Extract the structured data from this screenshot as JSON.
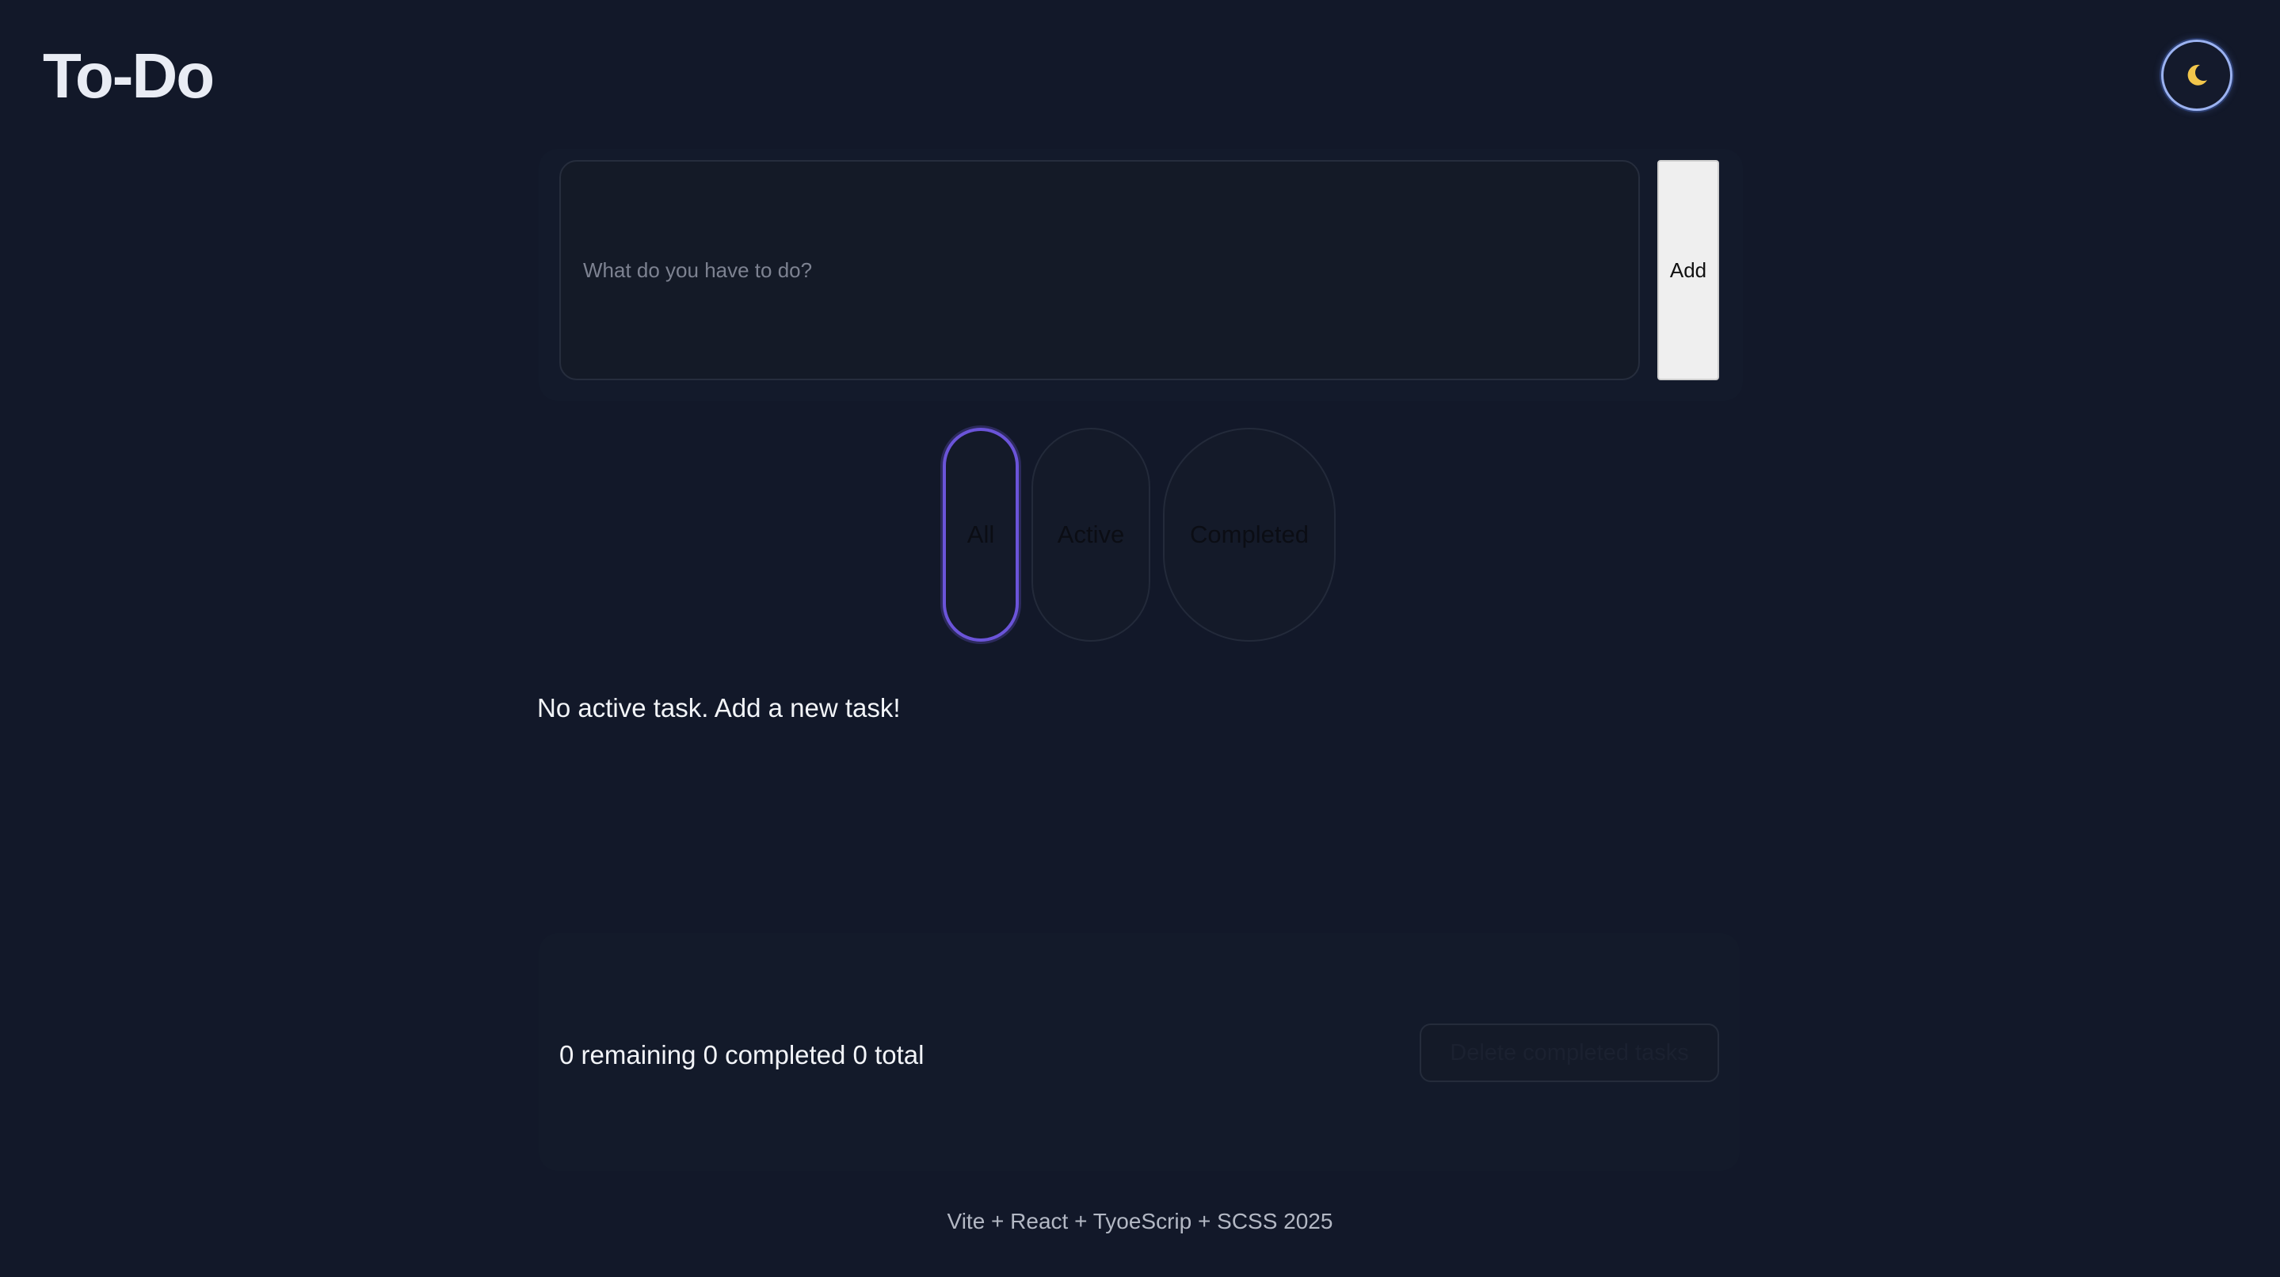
{
  "header": {
    "title": "To-Do",
    "theme_toggle_icon": "moon-icon"
  },
  "add_task": {
    "input_value": "",
    "input_placeholder": "What do you have to do?",
    "add_label": "Add"
  },
  "filters": {
    "items": [
      {
        "label": "All",
        "selected": true
      },
      {
        "label": "Active",
        "selected": false
      },
      {
        "label": "Completed",
        "selected": false
      }
    ]
  },
  "task_list": {
    "empty_message": "No active task. Add a new task!"
  },
  "stats": {
    "summary": "0 remaining 0 completed 0 total",
    "clear_label": "Delete completed tasks"
  },
  "footer": {
    "text": "Vite + React + TyoeScrip + SCSS 2025"
  },
  "colors": {
    "background": "#121829",
    "accent": "#6b54d9",
    "moon": "#f2c64b"
  }
}
